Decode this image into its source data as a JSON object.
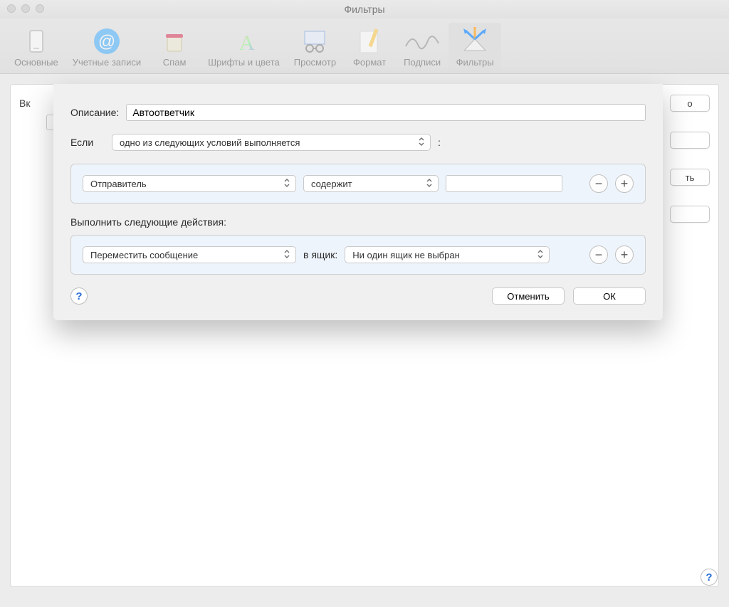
{
  "window": {
    "title": "Фильтры"
  },
  "toolbar": {
    "items": [
      {
        "label": "Основные"
      },
      {
        "label": "Учетные записи"
      },
      {
        "label": "Спам"
      },
      {
        "label": "Шрифты и цвета"
      },
      {
        "label": "Просмотр"
      },
      {
        "label": "Формат"
      },
      {
        "label": "Подписи"
      },
      {
        "label": "Фильтры"
      }
    ]
  },
  "background": {
    "col_header_left": "Вк",
    "button_right_fragment": "о",
    "button_fragment_2": "ть"
  },
  "sheet": {
    "description_label": "Описание:",
    "description_value": "Автоответчик",
    "if_label": "Если",
    "if_select": "одно из следующих условий выполняется",
    "if_colon": ":",
    "condition": {
      "field_select": "Отправитель",
      "op_select": "содержит",
      "value": ""
    },
    "actions_label": "Выполнить следующие действия:",
    "action": {
      "action_select": "Переместить сообщение",
      "to_label": "в ящик:",
      "mailbox_select": "Ни один ящик не выбран"
    },
    "buttons": {
      "cancel": "Отменить",
      "ok": "ОК"
    },
    "help": "?"
  },
  "global_help": "?"
}
